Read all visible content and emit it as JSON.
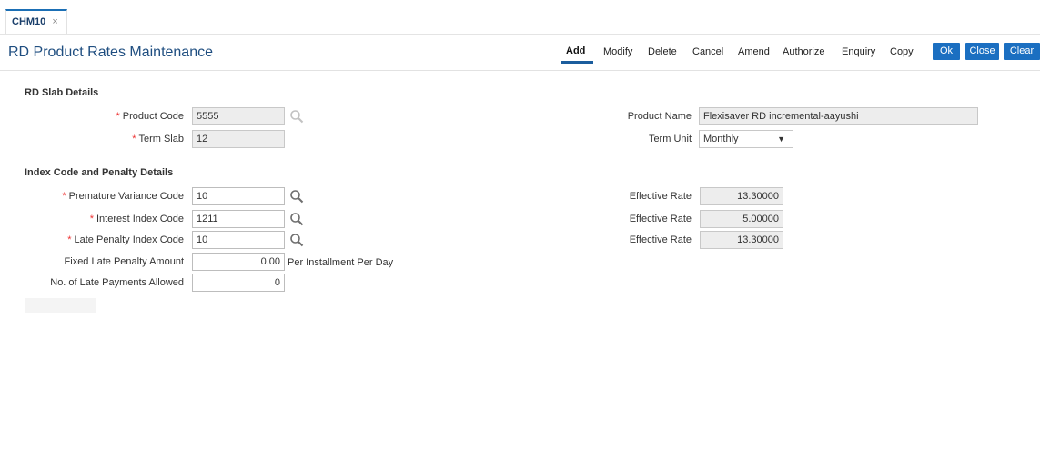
{
  "tab": {
    "label": "CHM10",
    "close": "×"
  },
  "page": {
    "title": "RD Product Rates Maintenance"
  },
  "toolbar": {
    "links": [
      "Add",
      "Modify",
      "Delete",
      "Cancel",
      "Amend",
      "Authorize",
      "Enquiry",
      "Copy"
    ],
    "buttons": [
      "Ok",
      "Close",
      "Clear"
    ]
  },
  "sections": {
    "slab": "RD Slab Details",
    "penalty": "Index Code and Penalty Details"
  },
  "slab": {
    "product_code_label": "Product Code",
    "product_code_value": "5555",
    "term_slab_label": "Term Slab",
    "term_slab_value": "12",
    "product_name_label": "Product Name",
    "product_name_value": "Flexisaver RD incremental-aayushi",
    "term_unit_label": "Term Unit",
    "term_unit_value": "Monthly",
    "required_mark": "*"
  },
  "penalty": {
    "premature_label": "Premature Variance Code",
    "premature_value": "10",
    "interest_label": "Interest Index Code",
    "interest_value": "1211",
    "late_penalty_label": "Late Penalty Index Code",
    "late_penalty_value": "10",
    "fixed_amount_label": "Fixed Late Penalty Amount",
    "fixed_amount_value": "0.00",
    "fixed_amount_suffix": "Per Installment Per Day",
    "late_payments_label": "No. of Late Payments Allowed",
    "late_payments_value": "0",
    "effective_rate_label": "Effective Rate",
    "effective_rate_1": "13.30000",
    "effective_rate_2": "5.00000",
    "effective_rate_3": "13.30000"
  },
  "icons": {
    "search": "magnifier-icon",
    "dropdown": "triangle-down"
  },
  "colors": {
    "primary_button": "#1b6fc1",
    "title": "#1f4e80",
    "required": "#e33333"
  }
}
